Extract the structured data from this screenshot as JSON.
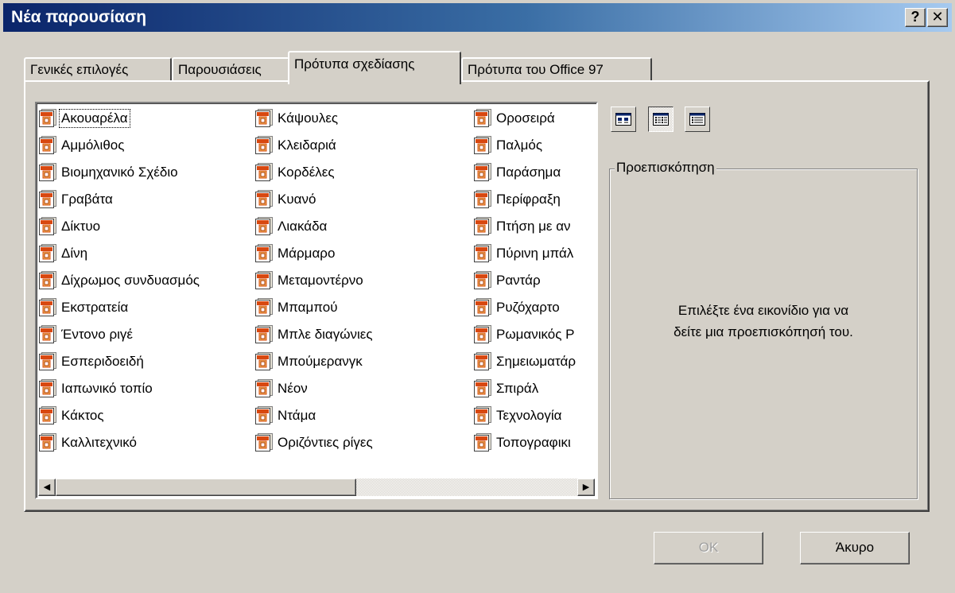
{
  "dialog": {
    "title": "Νέα παρουσίαση",
    "help_button": "?",
    "close_button": "✕"
  },
  "tabs": [
    {
      "label": "Γενικές επιλογές"
    },
    {
      "label": "Παρουσιάσεις"
    },
    {
      "label": "Πρότυπα σχεδίασης"
    },
    {
      "label": "Πρότυπα του Office 97"
    }
  ],
  "active_tab": "Πρότυπα σχεδίασης",
  "templates": {
    "columns": [
      [
        "Ακουαρέλα",
        "Αμμόλιθος",
        "Βιομηχανικό Σχέδιο",
        "Γραβάτα",
        "Δίκτυο",
        "Δίνη",
        "Δίχρωμος συνδυασμός",
        "Εκστρατεία",
        "Έντονο ριγέ",
        "Εσπεριδοειδή",
        "Ιαπωνικό τοπίο",
        "Κάκτος",
        "Καλλιτεχνικό"
      ],
      [
        "Κάψουλες",
        "Κλειδαριά",
        "Κορδέλες",
        "Κυανό",
        "Λιακάδα",
        "Μάρμαρο",
        "Μεταμοντέρνο",
        "Μπαμπού",
        "Μπλε διαγώνιες",
        "Μπούμερανγκ",
        "Νέον",
        "Ντάμα",
        "Οριζόντιες ρίγες"
      ],
      [
        "Οροσειρά",
        "Παλμός",
        "Παράσημα",
        "Περίφραξη",
        "Πτήση με αν",
        "Πύρινη μπάλ",
        "Ραντάρ",
        "Ρυζόχαρτο",
        "Ρωμανικός Ρ",
        "Σημειωματάρ",
        "Σπιράλ",
        "Τεχνολογία",
        "Τοπογραφικι"
      ]
    ],
    "focused": "Ακουαρέλα"
  },
  "view_buttons": [
    "large-icons-icon",
    "list-icon",
    "details-icon"
  ],
  "preview": {
    "legend": "Προεπισκόπηση",
    "line1": "Επιλέξτε ένα εικονίδιο για να",
    "line2": "δείτε μια προεπισκόπησή του."
  },
  "buttons": {
    "ok": "OK",
    "cancel": "Άκυρο"
  }
}
